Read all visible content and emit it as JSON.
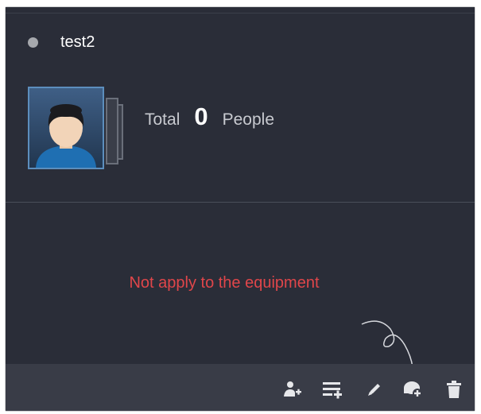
{
  "group": {
    "name": "test2",
    "status_color": "#a6a8ad"
  },
  "summary": {
    "total_label": "Total",
    "count": "0",
    "people_label": "People"
  },
  "message": {
    "text": "Not apply to the equipment",
    "color": "#e0464a"
  },
  "toolbar": {
    "buttons": [
      {
        "icon": "add-person-icon"
      },
      {
        "icon": "add-list-icon"
      },
      {
        "icon": "edit-pencil-icon"
      },
      {
        "icon": "add-device-icon"
      },
      {
        "icon": "delete-trash-icon"
      }
    ]
  },
  "colors": {
    "card_bg": "#2a2d38",
    "toolbar_bg": "#393c47",
    "icon": "#e6e7ea"
  }
}
